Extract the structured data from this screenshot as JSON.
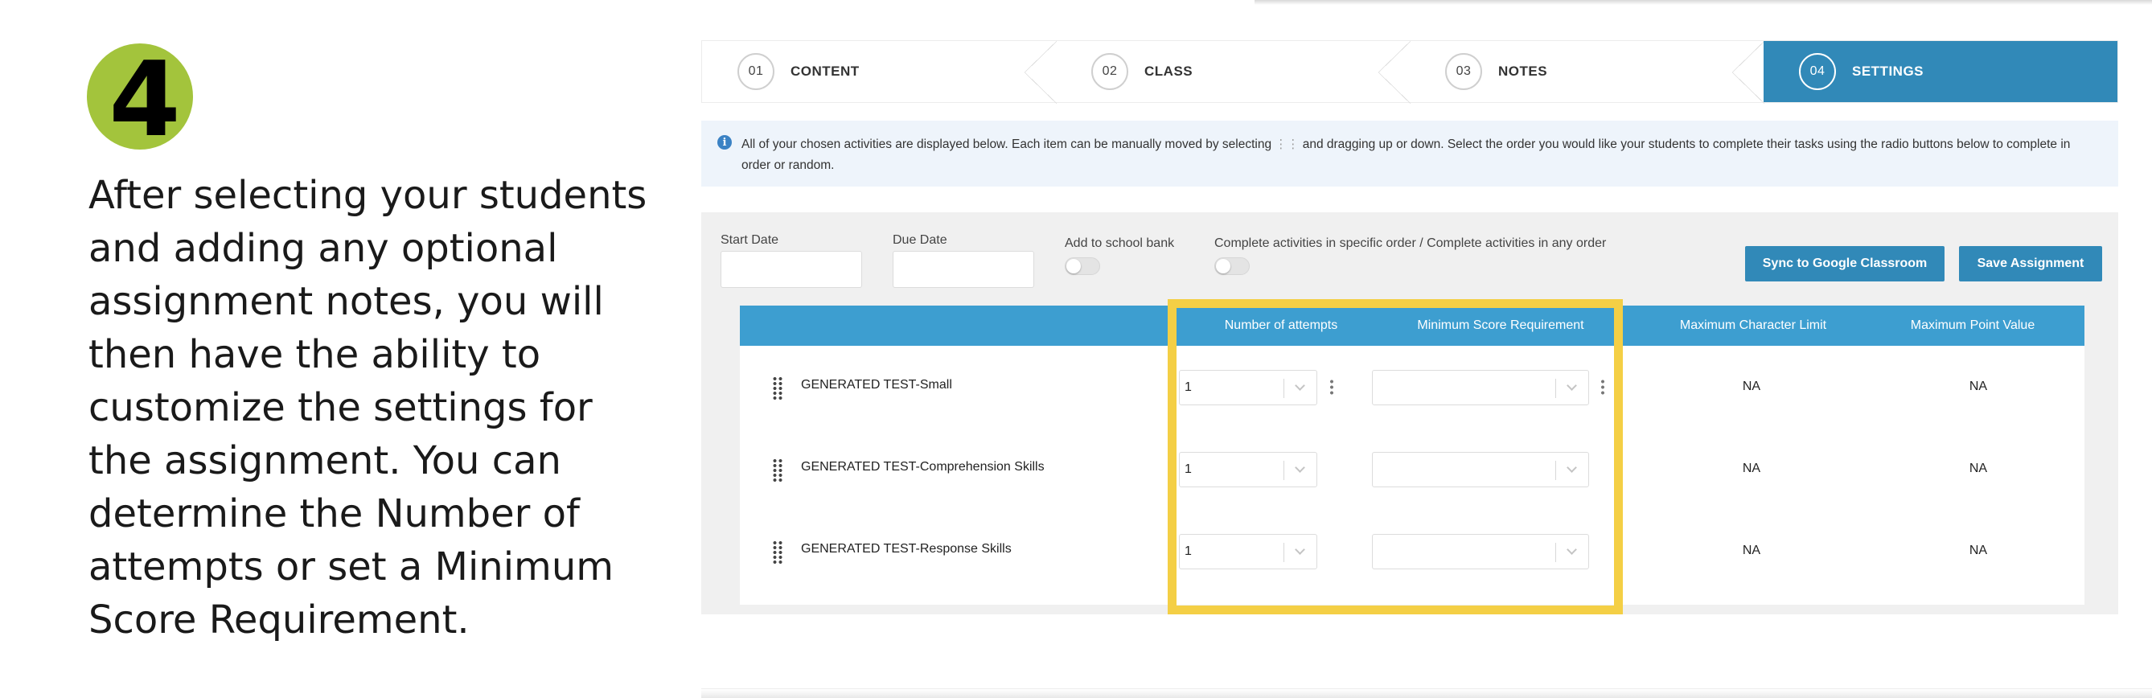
{
  "step_badge": "4",
  "instructions": "After selecting your students and adding any optional assignment notes, you will then have the ability to customize the settings for the assignment. You can determine the Number of attempts or set a Minimum Score Requirement.",
  "stepper": [
    {
      "num": "01",
      "label": "CONTENT",
      "active": false
    },
    {
      "num": "02",
      "label": "CLASS",
      "active": false
    },
    {
      "num": "03",
      "label": "NOTES",
      "active": false
    },
    {
      "num": "04",
      "label": "SETTINGS",
      "active": true
    }
  ],
  "info": {
    "text_before": "All of your chosen activities are displayed below. Each item can be manually moved by selecting",
    "drag_glyph": "⋮⋮",
    "text_after": "and dragging up or down. Select the order you would like your students to complete their tasks using the radio buttons below to complete in order or random."
  },
  "form": {
    "start_date_label": "Start Date",
    "due_date_label": "Due Date",
    "school_bank_label": "Add to school bank",
    "order_label": "Complete activities in specific order / Complete activities in any order",
    "sync_button": "Sync to Google Classroom",
    "save_button": "Save Assignment"
  },
  "table": {
    "headers": {
      "attempts": "Number of attempts",
      "min_score": "Minimum Score Requirement",
      "max_char": "Maximum Character Limit",
      "max_point": "Maximum Point Value"
    },
    "rows": [
      {
        "name": "GENERATED TEST-Small",
        "attempts": "1",
        "min_score": "",
        "max_char": "NA",
        "max_point": "NA"
      },
      {
        "name": "GENERATED TEST-Comprehension Skills",
        "attempts": "1",
        "min_score": "",
        "max_char": "NA",
        "max_point": "NA"
      },
      {
        "name": "GENERATED TEST-Response Skills",
        "attempts": "1",
        "min_score": "",
        "max_char": "NA",
        "max_point": "NA"
      }
    ]
  },
  "colors": {
    "accent": "#3189b8",
    "table_header": "#3d9ed0",
    "highlight": "#f4cf45",
    "step_badge": "#a3c43c"
  },
  "icons": {
    "info": "info-icon",
    "drag": "drag-handle-icon",
    "dropdown": "chevron-down-icon",
    "more": "kebab-menu-icon"
  }
}
